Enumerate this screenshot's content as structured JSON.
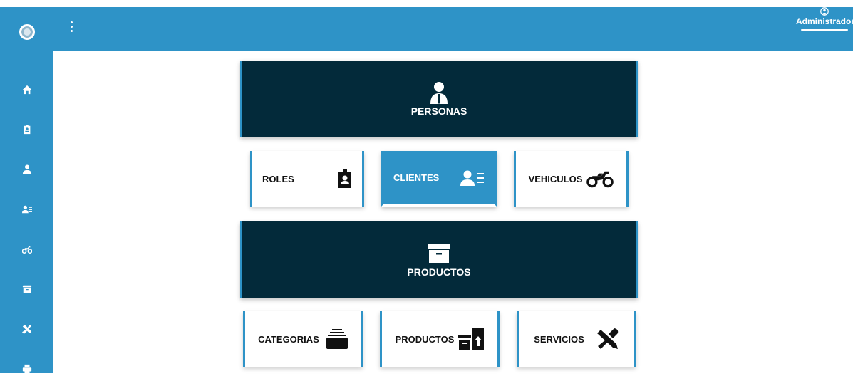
{
  "user": {
    "name": "Administrador",
    "icon": "user-circle-icon"
  },
  "sidebar": {
    "items": [
      {
        "icon": "home-icon"
      },
      {
        "icon": "id-badge-icon"
      },
      {
        "icon": "user-tie-icon"
      },
      {
        "icon": "address-card-icon"
      },
      {
        "icon": "motorcycle-icon"
      },
      {
        "icon": "archive-box-icon"
      },
      {
        "icon": "tools-icon"
      },
      {
        "icon": "printer-icon"
      }
    ]
  },
  "sections": {
    "personas": {
      "label": "PERSONAS",
      "cards": {
        "roles": "ROLES",
        "clientes": "CLIENTES",
        "vehiculos": "VEHICULOS"
      }
    },
    "productos": {
      "label": "PRODUCTOS",
      "cards": {
        "categorias": "CATEGORIAS",
        "productos": "PRODUCTOS",
        "servicios": "SERVICIOS"
      }
    }
  },
  "colors": {
    "primary": "#2e93c7",
    "dark": "#032a3a",
    "white": "#ffffff"
  }
}
